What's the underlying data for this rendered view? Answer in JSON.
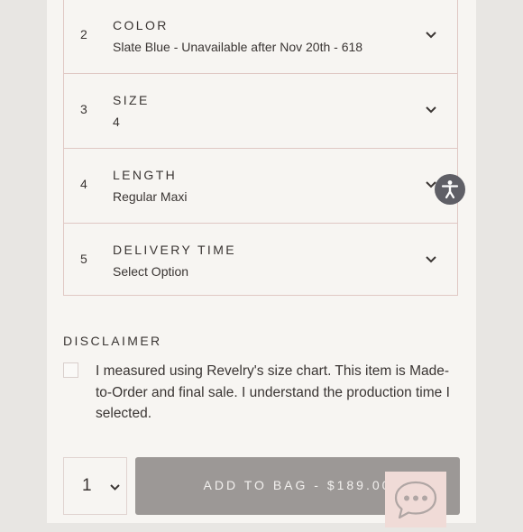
{
  "options": [
    {
      "number": "2",
      "label": "COLOR",
      "value": "Slate Blue - Unavailable after Nov 20th - 618"
    },
    {
      "number": "3",
      "label": "SIZE",
      "value": "4"
    },
    {
      "number": "4",
      "label": "LENGTH",
      "value": "Regular Maxi"
    },
    {
      "number": "5",
      "label": "DELIVERY TIME",
      "value": "Select Option"
    }
  ],
  "disclaimer": {
    "title": "DISCLAIMER",
    "text": "I measured using Revelry's size chart. This item is Made-to-Order and final sale. I understand the production time I selected.",
    "checked": false
  },
  "purchase": {
    "quantity": "1",
    "add_to_bag_label": "ADD TO BAG - $189.00"
  },
  "icons": {
    "option_chevron": "chevron-down-icon",
    "accessibility": "accessibility-icon",
    "chat": "chat-bubble-icon"
  },
  "colors": {
    "border": "#e0c8c4",
    "button": "#9c9896",
    "chat_bg": "#f0dbd7",
    "accessibility_bg": "#5f5f66"
  }
}
